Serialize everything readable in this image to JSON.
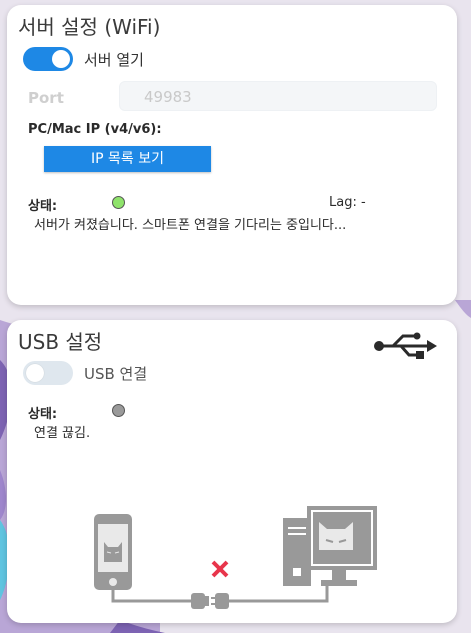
{
  "wifi": {
    "title": "서버 설정 (WiFi)",
    "toggle_label": "서버 열기",
    "toggle_on": true,
    "port_label": "Port",
    "port_value": "49983",
    "ip_label": "PC/Mac IP (v4/v6):",
    "ip_button": "IP 목록 보기",
    "status_label": "상태:",
    "status_color": "#8fe36b",
    "lag": "Lag: -",
    "status_message": "서버가 켜졌습니다. 스마트폰 연결을 기다리는 중입니다..."
  },
  "usb": {
    "title": "USB 설정",
    "toggle_label": "USB 연결",
    "toggle_on": false,
    "status_label": "상태:",
    "status_color": "#9a9a9a",
    "status_message": "연결 끊김.",
    "icons": [
      "usb-icon",
      "phone-icon",
      "computer-icon",
      "plug-icon",
      "disconnect-x-icon"
    ]
  },
  "colors": {
    "accent": "#1e88e5",
    "illustration_gray": "#999999",
    "disconnect_red": "#e8354b"
  }
}
